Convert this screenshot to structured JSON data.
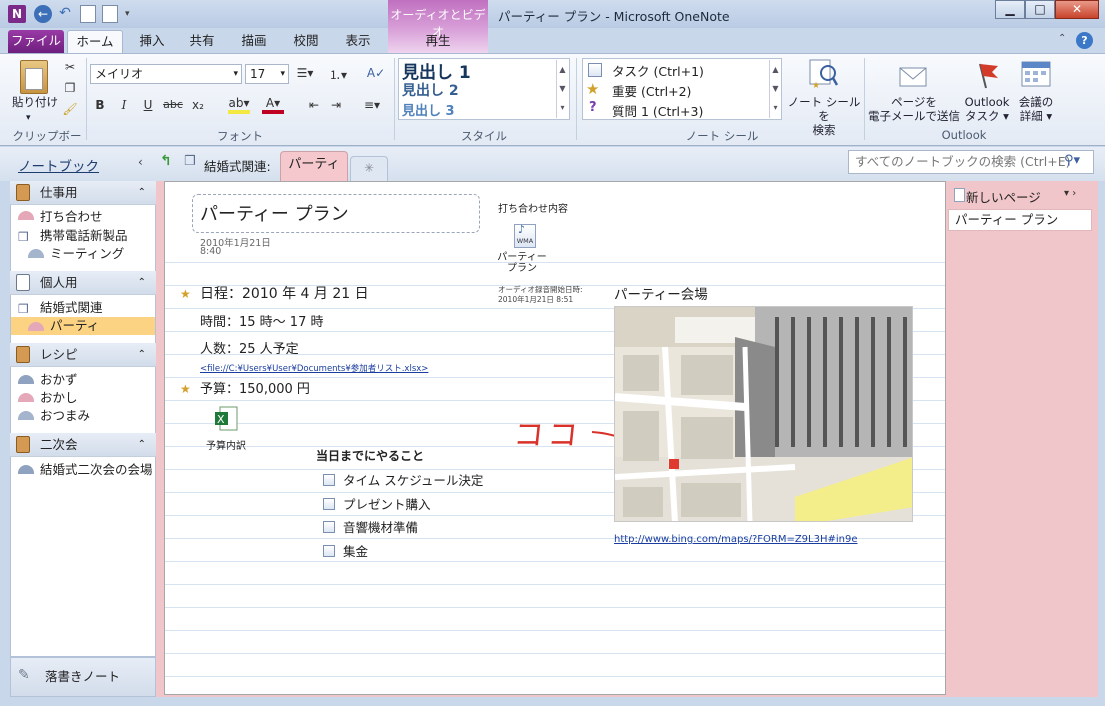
{
  "window": {
    "title": "パーティー プラン - Microsoft OneNote"
  },
  "ribbon_tabs": {
    "file": "ファイル",
    "home": "ホーム",
    "insert": "挿入",
    "share": "共有",
    "draw": "描画",
    "review": "校閲",
    "view": "表示",
    "contextual_title": "オーディオとビデオ",
    "playback": "再生"
  },
  "clipboard": {
    "paste": "貼り付け",
    "group": "クリップボード"
  },
  "font": {
    "name": "メイリオ",
    "size": "17",
    "group": "フォント",
    "bold": "B",
    "italic": "I",
    "underline": "U",
    "strike": "abc",
    "sub": "x₂"
  },
  "styles": {
    "h1": "見出し 1",
    "h2": "見出し 2",
    "h3": "見出し 3",
    "group": "スタイル"
  },
  "tags": {
    "task": "タスク (Ctrl+1)",
    "important": "重要 (Ctrl+2)",
    "question": "質問 1 (Ctrl+3)",
    "find": "ノート シールを\n検索",
    "group": "ノート シール"
  },
  "outlook": {
    "email": "ページを\n電子メールで送信",
    "tasks": "Outlook\nタスク ▾",
    "meeting": "会議の\n詳細 ▾",
    "group": "Outlook"
  },
  "nav": {
    "notebook_label": "ノートブック",
    "section_group": "結婚式関連:",
    "active_section": "パーティ",
    "search_placeholder": "すべてのノートブックの検索 (Ctrl+E)"
  },
  "notebooks": [
    {
      "name": "仕事用",
      "color": "#d49a54",
      "sections": [
        "打ち合わせ",
        "携帯電話新製品",
        "ミーティング"
      ]
    },
    {
      "name": "個人用",
      "color": "#d49a54",
      "sections": [
        "結婚式関連",
        "パーティ"
      ]
    },
    {
      "name": "レシピ",
      "color": "#d49a54",
      "sections": [
        "おかず",
        "おかし",
        "おつまみ"
      ]
    },
    {
      "name": "二次会",
      "color": "#d49a54",
      "sections": [
        "結婚式二次会の会場"
      ]
    }
  ],
  "drafts": "落書きノート",
  "pages": {
    "new_page": "新しいページ",
    "items": [
      "パーティー プラン"
    ]
  },
  "note": {
    "title": "パーティー プラン",
    "date": "2010年1月21日",
    "time": "8:40",
    "meeting_label": "打ち合わせ内容",
    "audio_label": "パーティー\nプラン",
    "audio_icon": "WMA",
    "audio_meta": "オーディオ録音開始日時:\n2010年1月21日 8:51",
    "schedule": "日程：2010 年 4 月 21 日",
    "hours": "時間：15 時～ 17 時",
    "people": "人数：25 人予定",
    "file_link": "<file://C:¥Users¥User¥Documents¥参加者リスト.xlsx>",
    "budget": "予算：150,000 円",
    "excel_label": "予算内訳",
    "venue_title": "パーティー会場",
    "map_link": "http://www.bing.com/maps/?FORM=Z9L3H#in9e",
    "handwriting": "ココ",
    "todo_title": "当日までにやること",
    "todos": [
      "タイム スケジュール決定",
      "プレゼント購入",
      "音響機材準備",
      "集金"
    ]
  }
}
